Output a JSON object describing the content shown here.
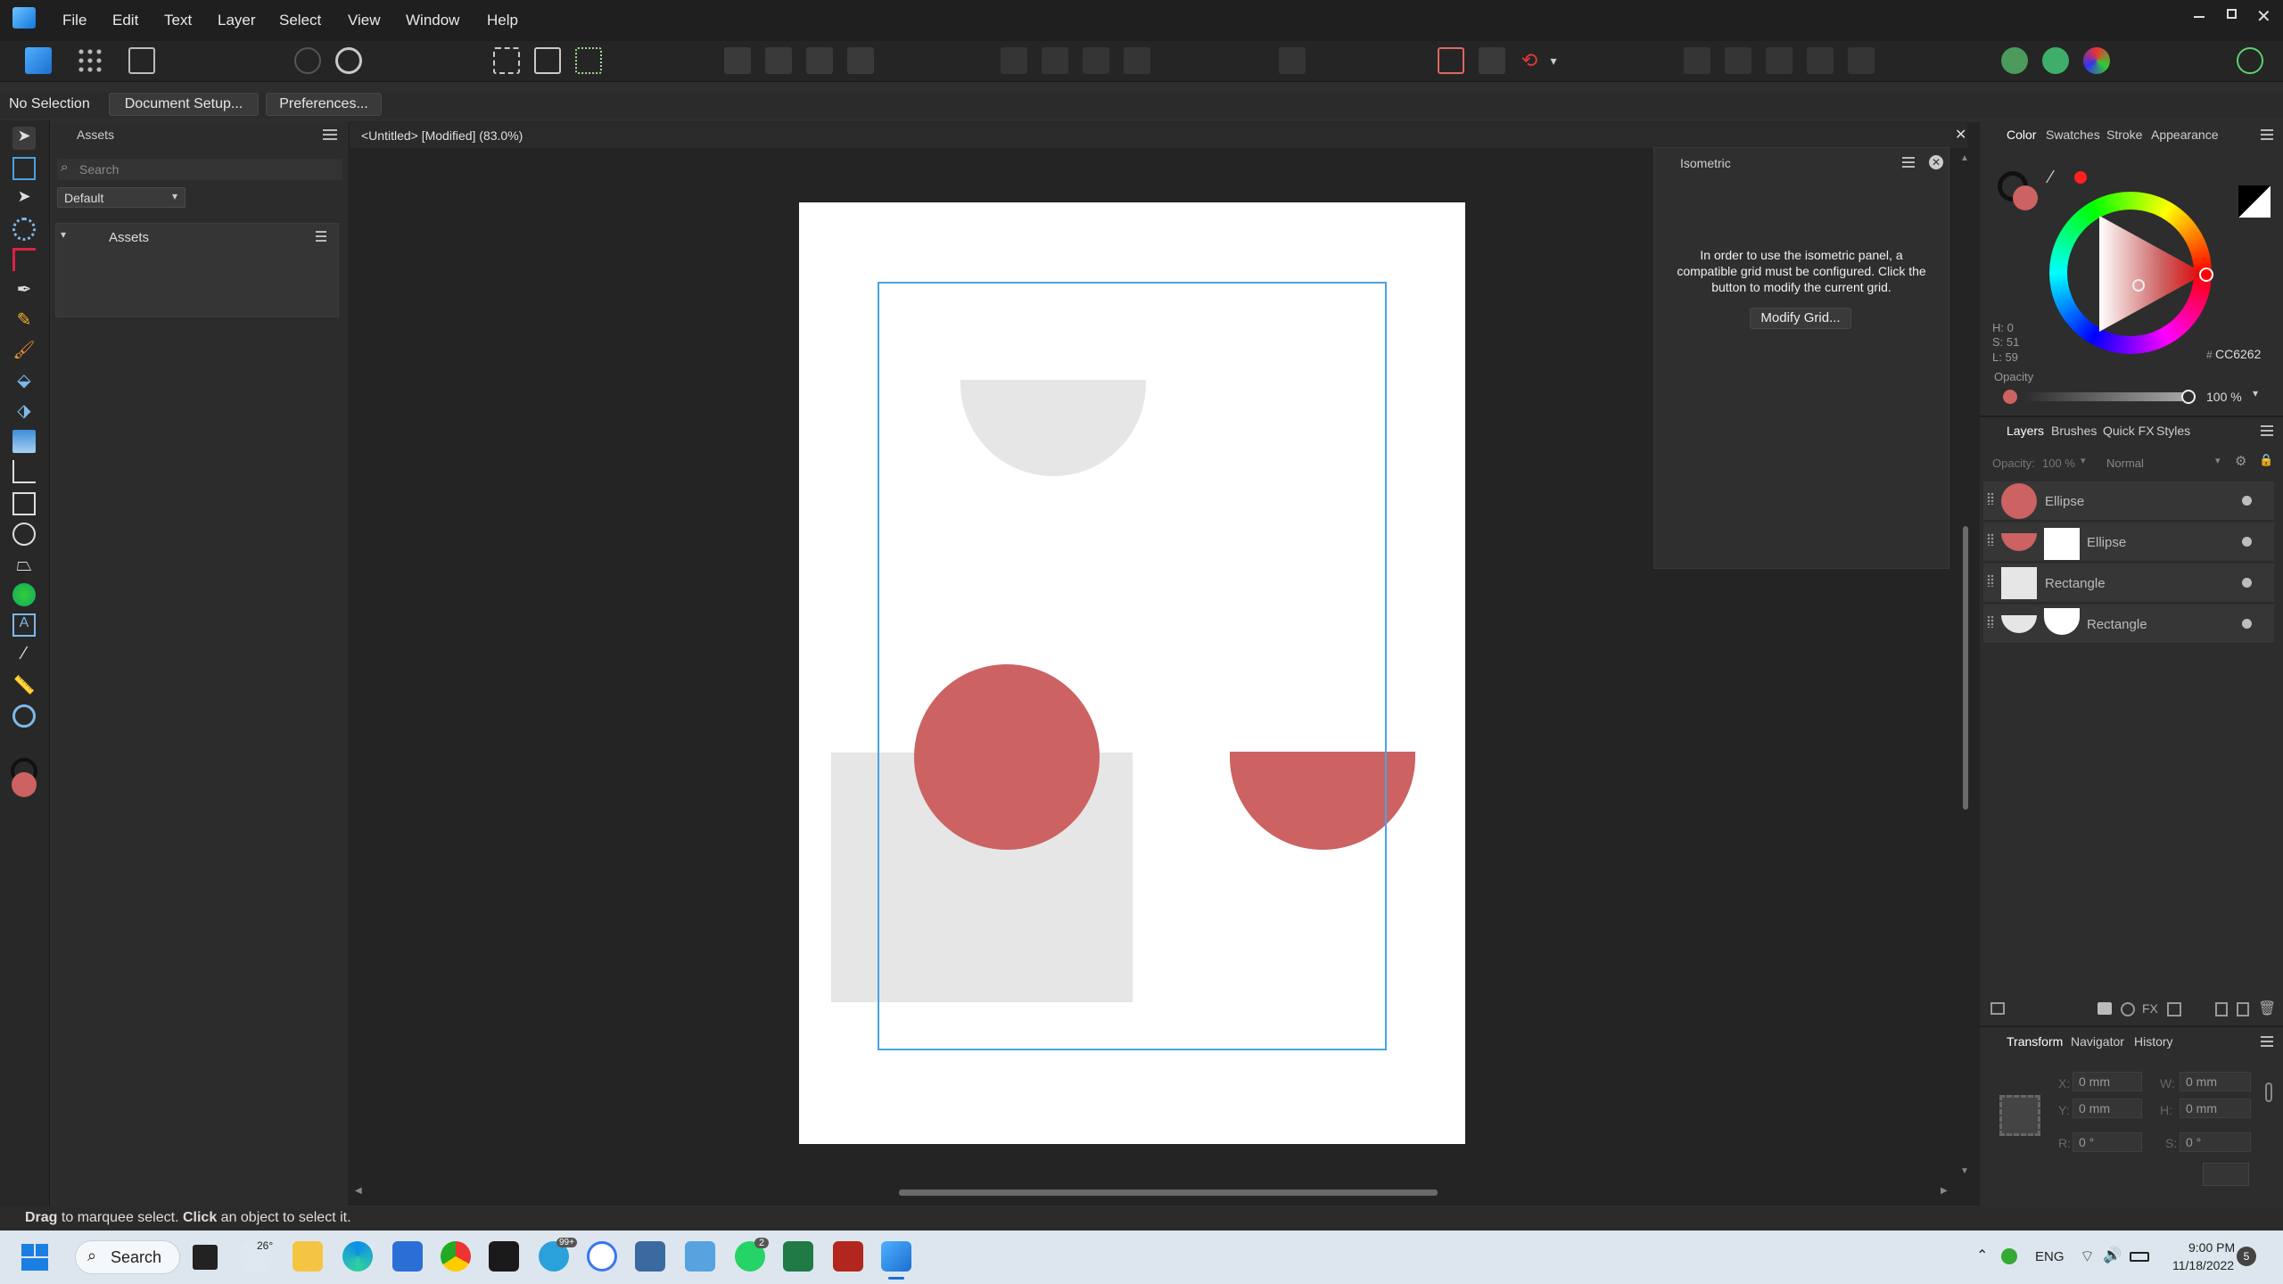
{
  "menu": {
    "items": [
      "File",
      "Edit",
      "Text",
      "Layer",
      "Select",
      "View",
      "Window",
      "Help"
    ]
  },
  "context": {
    "selection": "No Selection",
    "document_setup": "Document Setup...",
    "preferences": "Preferences..."
  },
  "assets_panel": {
    "tab": "Assets",
    "search_placeholder": "Search",
    "dropdown_value": "Default",
    "section": "Assets"
  },
  "document": {
    "title": "<Untitled> [Modified] (83.0%)"
  },
  "isometric": {
    "title": "Isometric",
    "message": "In order to use the isometric panel, a compatible grid must be configured. Click the button to modify the current grid.",
    "button": "Modify Grid..."
  },
  "color_panel": {
    "tabs": [
      "Color",
      "Swatches",
      "Stroke",
      "Appearance"
    ],
    "h": "H: 0",
    "s": "S: 51",
    "l": "L: 59",
    "hex_label": "#",
    "hex": "CC6262",
    "opacity_label": "Opacity",
    "opacity_value": "100 %"
  },
  "layers_panel": {
    "tabs": [
      "Layers",
      "Brushes",
      "Quick FX",
      "Styles"
    ],
    "opacity_label": "Opacity:",
    "opacity_value": "100 %",
    "blend_mode": "Normal",
    "layers": [
      "Ellipse",
      "Ellipse",
      "Rectangle",
      "Rectangle"
    ]
  },
  "transform_panel": {
    "tabs": [
      "Transform",
      "Navigator",
      "History"
    ],
    "x_label": "X:",
    "x": "0 mm",
    "y_label": "Y:",
    "y": "0 mm",
    "w_label": "W:",
    "w": "0 mm",
    "h_label": "H:",
    "h": "0 mm",
    "r_label": "R:",
    "r": "0 °",
    "s_label": "S:",
    "s": "0 °"
  },
  "status": {
    "drag": "Drag",
    "drag_text": " to marquee select. ",
    "click": "Click",
    "click_text": " an object to select it."
  },
  "taskbar": {
    "search": "Search",
    "weather": "26°",
    "telegram_badge": "99+",
    "whatsapp_badge": "2",
    "lang": "ENG",
    "time": "9:00 PM",
    "date": "11/18/2022",
    "notif": "5"
  },
  "colors": {
    "accent": "#1e90ff",
    "shape_red": "#cc6262",
    "shape_grey": "#e6e6e6",
    "guide_blue": "#4aa3df"
  }
}
